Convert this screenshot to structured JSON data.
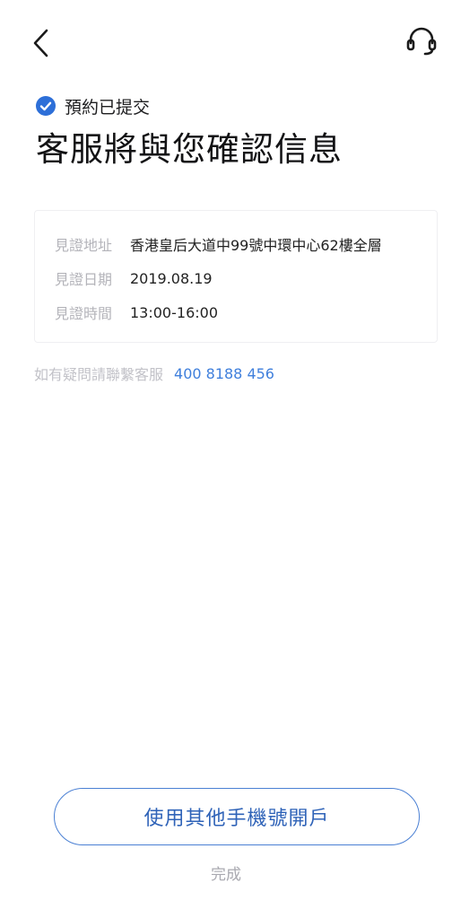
{
  "header": {
    "back_icon": "chevron-left-icon",
    "support_icon": "headset-icon"
  },
  "status": {
    "icon": "check-circle-icon",
    "icon_color": "#2d6fd8",
    "text": "預約已提交"
  },
  "title": "客服將與您確認信息",
  "details": {
    "rows": [
      {
        "label": "見證地址",
        "value": "香港皇后大道中99號中環中心62樓全層"
      },
      {
        "label": "見證日期",
        "value": "2019.08.19"
      },
      {
        "label": "見證時間",
        "value": "13:00-16:00"
      }
    ]
  },
  "contact": {
    "label": "如有疑問請聯繫客服",
    "phone": "400 8188 456",
    "phone_color": "#3f7fdc"
  },
  "actions": {
    "other_phone_label": "使用其他手機號開戶",
    "done_label": "完成",
    "accent": "#4b80d4"
  }
}
